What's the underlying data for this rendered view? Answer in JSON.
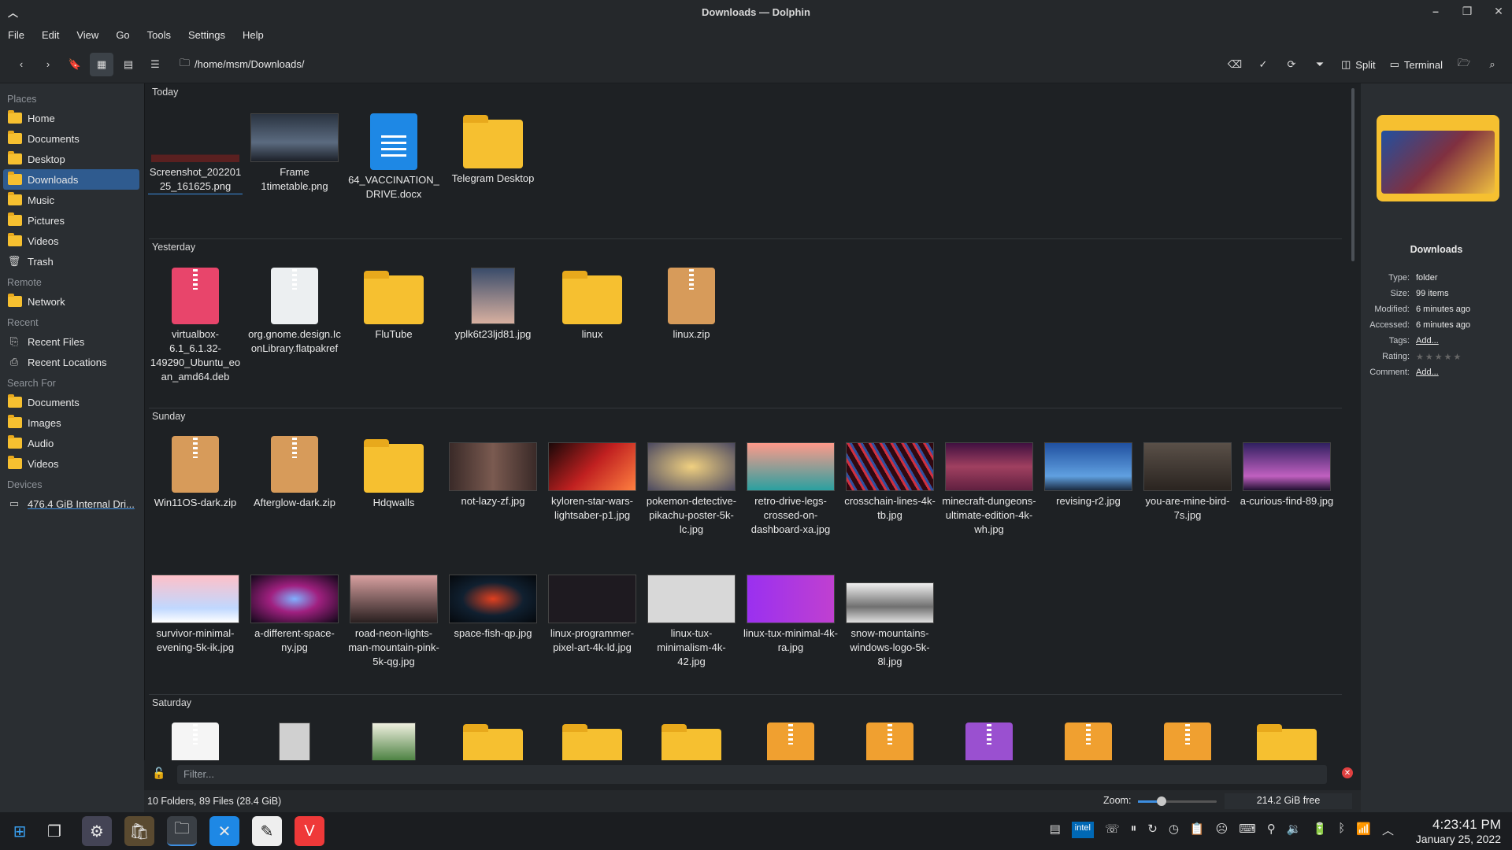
{
  "window": {
    "title": "Downloads — Dolphin"
  },
  "menu": [
    "File",
    "Edit",
    "View",
    "Go",
    "Tools",
    "Settings",
    "Help"
  ],
  "toolbar": {
    "path": "/home/msm/Downloads/",
    "split_label": "Split",
    "terminal_label": "Terminal"
  },
  "sidebar": {
    "places_title": "Places",
    "places": [
      "Home",
      "Documents",
      "Desktop",
      "Downloads",
      "Music",
      "Pictures",
      "Videos",
      "Trash"
    ],
    "remote_title": "Remote",
    "remote": [
      "Network"
    ],
    "recent_title": "Recent",
    "recent": [
      "Recent Files",
      "Recent Locations"
    ],
    "search_title": "Search For",
    "search": [
      "Documents",
      "Images",
      "Audio",
      "Videos"
    ],
    "devices_title": "Devices",
    "devices": [
      "476.4 GiB Internal Dri..."
    ]
  },
  "groups": {
    "today": "Today",
    "yesterday": "Yesterday",
    "sunday": "Sunday",
    "saturday": "Saturday"
  },
  "files": {
    "today": [
      "Screenshot_20220125_161625.png",
      "Frame 1timetable.png",
      "64_VACCINATION_DRIVE.docx",
      "Telegram Desktop"
    ],
    "yesterday": [
      "virtualbox-6.1_6.1.32-149290_Ubuntu_eoan_amd64.deb",
      "org.gnome.design.IconLibrary.flatpakref",
      "FluTube",
      "yplk6t23ljd81.jpg",
      "linux",
      "linux.zip"
    ],
    "sunday1": [
      "Win11OS-dark.zip",
      "Afterglow-dark.zip",
      "Hdqwalls",
      "not-lazy-zf.jpg",
      "kyloren-star-wars-lightsaber-p1.jpg",
      "pokemon-detective-pikachu-poster-5k-lc.jpg",
      "retro-drive-legs-crossed-on-dashboard-xa.jpg",
      "crosschain-lines-4k-tb.jpg",
      "minecraft-dungeons-ultimate-edition-4k-wh.jpg",
      "revising-r2.jpg",
      "you-are-mine-bird-7s.jpg",
      "a-curious-find-89.jpg"
    ],
    "sunday2": [
      "survivor-minimal-evening-5k-ik.jpg",
      "a-different-space-ny.jpg",
      "road-neon-lights-man-mountain-pink-5k-qg.jpg",
      "space-fish-qp.jpg",
      "linux-programmer-pixel-art-4k-ld.jpg",
      "linux-tux-minimalism-4k-42.jpg",
      "linux-tux-minimal-4k-ra.jpg",
      "snow-mountains-windows-logo-5k-8l.jpg"
    ]
  },
  "filter": {
    "placeholder": "Filter..."
  },
  "status": {
    "summary": "10 Folders, 89 Files (28.4 GiB)",
    "zoom_label": "Zoom:",
    "free": "214.2 GiB free",
    "zoom_level": 0.3
  },
  "info": {
    "name": "Downloads",
    "type_k": "Type:",
    "type_v": "folder",
    "size_k": "Size:",
    "size_v": "99 items",
    "mod_k": "Modified:",
    "mod_v": "6 minutes ago",
    "acc_k": "Accessed:",
    "acc_v": "6 minutes ago",
    "tags_k": "Tags:",
    "tags_v": "Add...",
    "rating_k": "Rating:",
    "comment_k": "Comment:",
    "comment_v": "Add..."
  },
  "clock": {
    "time": "4:23:41 PM",
    "date": "January 25, 2022"
  },
  "tray": {
    "intel": "intel"
  }
}
